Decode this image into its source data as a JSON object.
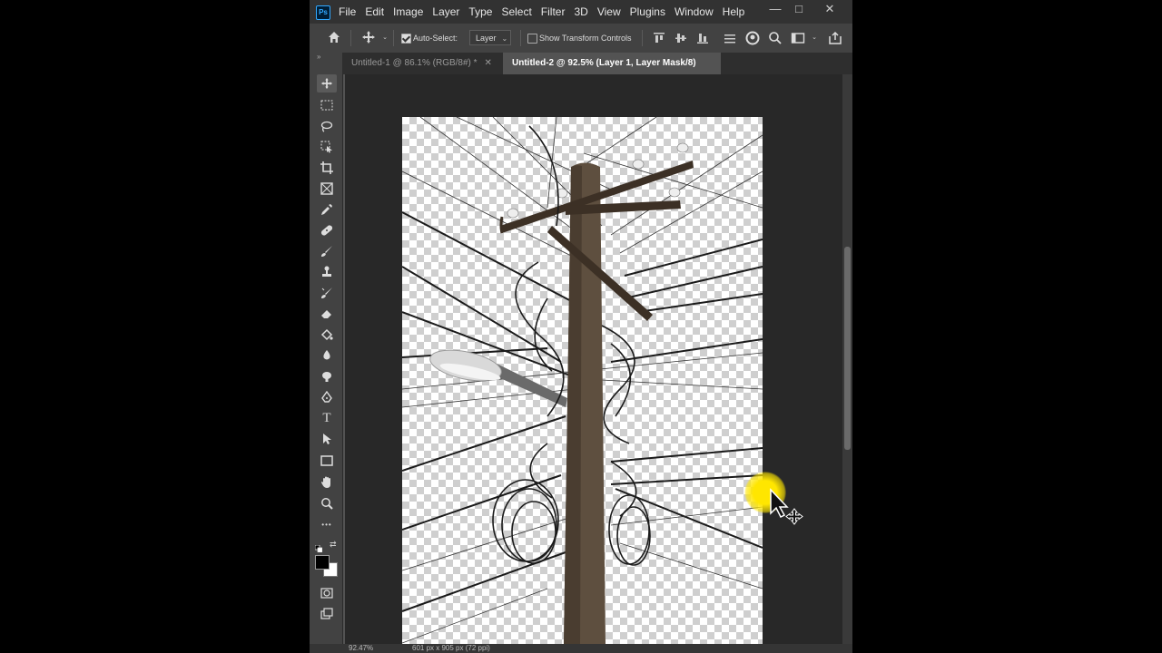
{
  "app": {
    "logo_text": "Ps"
  },
  "menu": [
    "File",
    "Edit",
    "Image",
    "Layer",
    "Type",
    "Select",
    "Filter",
    "3D",
    "View",
    "Plugins",
    "Window",
    "Help"
  ],
  "window_controls": {
    "minimize": "—",
    "maximize": "□",
    "close": "✕"
  },
  "options": {
    "auto_select_label": "Auto-Select:",
    "auto_select_checked": true,
    "auto_select_target": "Layer",
    "show_transform_label": "Show Transform Controls",
    "show_transform_checked": false
  },
  "tabs": [
    {
      "label": "Untitled-1 @ 86.1% (RGB/8#) *",
      "active": false
    },
    {
      "label": "Untitled-2 @ 92.5% (Layer 1, Layer Mask/8) *",
      "active": true
    }
  ],
  "toolbar": {
    "tools": [
      "move-tool",
      "marquee-tool",
      "lasso-tool",
      "object-selection-tool",
      "crop-tool",
      "frame-tool",
      "eyedropper-tool",
      "healing-brush-tool",
      "brush-tool",
      "clone-stamp-tool",
      "history-brush-tool",
      "eraser-tool",
      "paint-bucket-tool",
      "blur-tool",
      "dodge-tool",
      "pen-tool",
      "type-tool",
      "path-selection-tool",
      "rectangle-tool",
      "hand-tool",
      "zoom-tool",
      "edit-toolbar"
    ],
    "type_tool_glyph": "T",
    "more_glyph": "•••",
    "foreground_color": "#000000",
    "background_color": "#ffffff"
  },
  "status": {
    "zoom": "92.47%",
    "doc_info": "601 px x 905 px (72 ppi)"
  },
  "colors": {
    "accent": "#31a8ff",
    "cursor_highlight": "#ffe600"
  }
}
